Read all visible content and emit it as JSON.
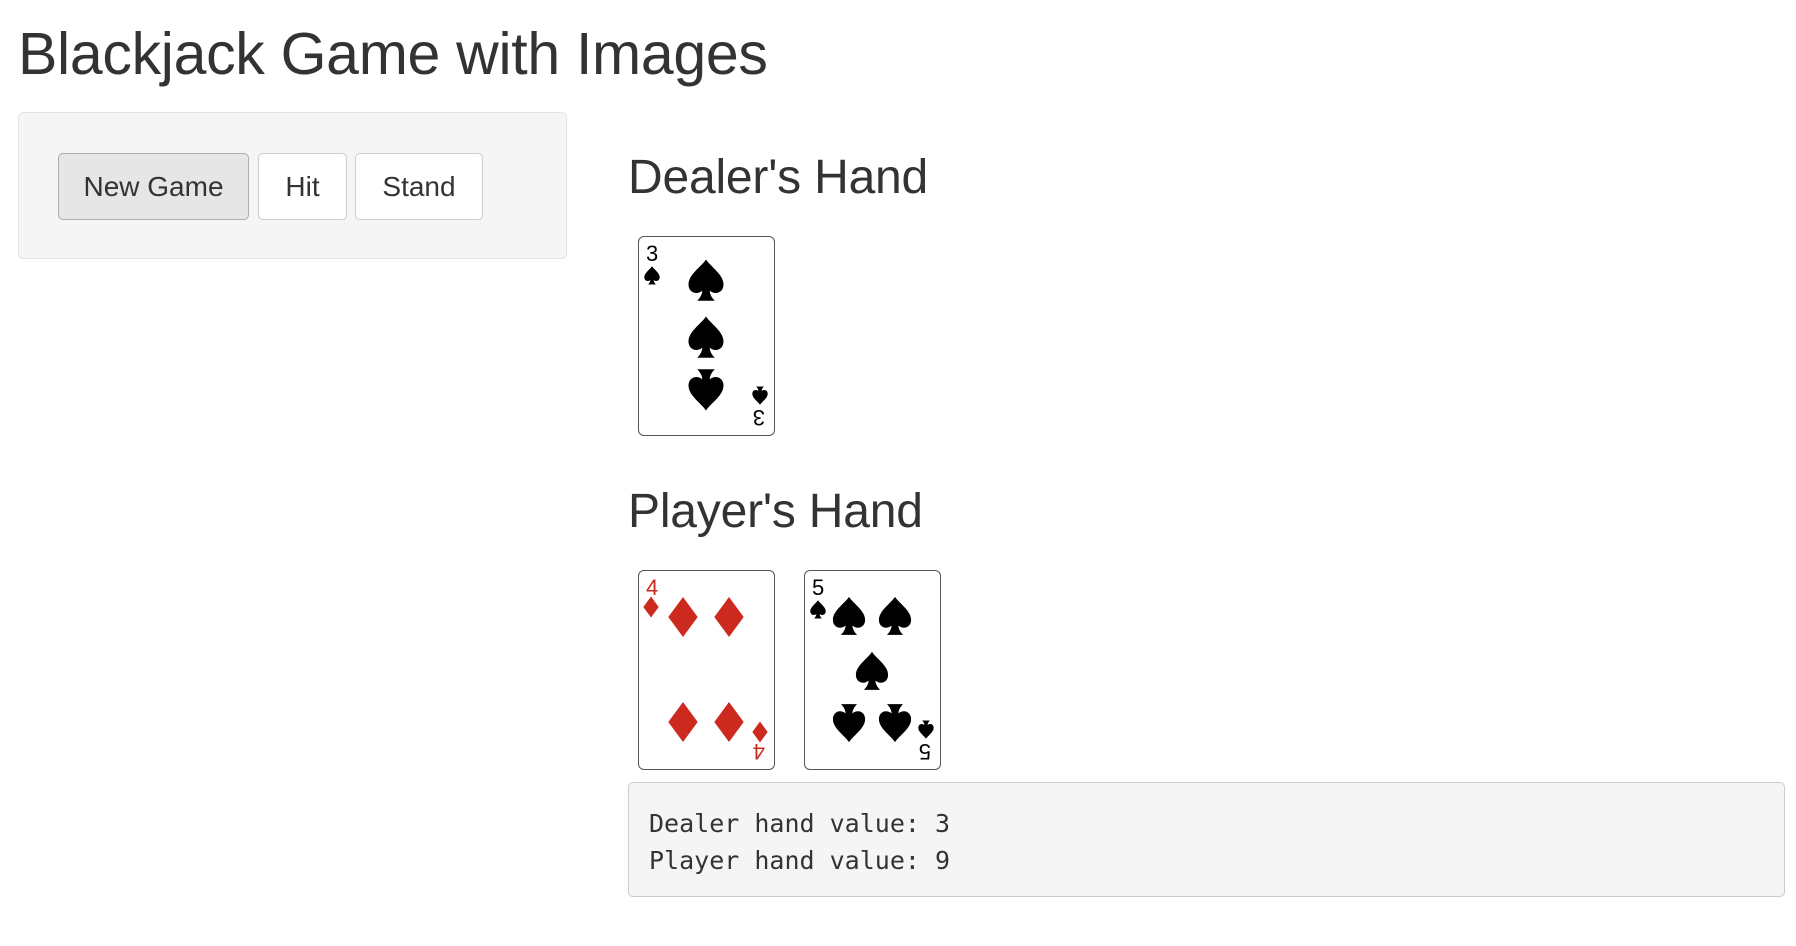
{
  "app": {
    "title": "Blackjack Game with Images"
  },
  "controls": {
    "new_game_label": "New Game",
    "hit_label": "Hit",
    "stand_label": "Stand"
  },
  "dealer": {
    "heading": "Dealer's Hand",
    "cards": [
      {
        "rank": "3",
        "suit": "spades",
        "icon": "spade-icon"
      }
    ]
  },
  "player": {
    "heading": "Player's Hand",
    "cards": [
      {
        "rank": "4",
        "suit": "diamonds",
        "icon": "diamond-icon"
      },
      {
        "rank": "5",
        "suit": "spades",
        "icon": "spade-icon"
      }
    ]
  },
  "output": {
    "line1": "Dealer hand value: 3",
    "line2": "Player hand value: 9"
  },
  "colors": {
    "red_suit": "#cc2a1f",
    "black_suit": "#000000",
    "panel_bg": "#f5f5f5"
  }
}
